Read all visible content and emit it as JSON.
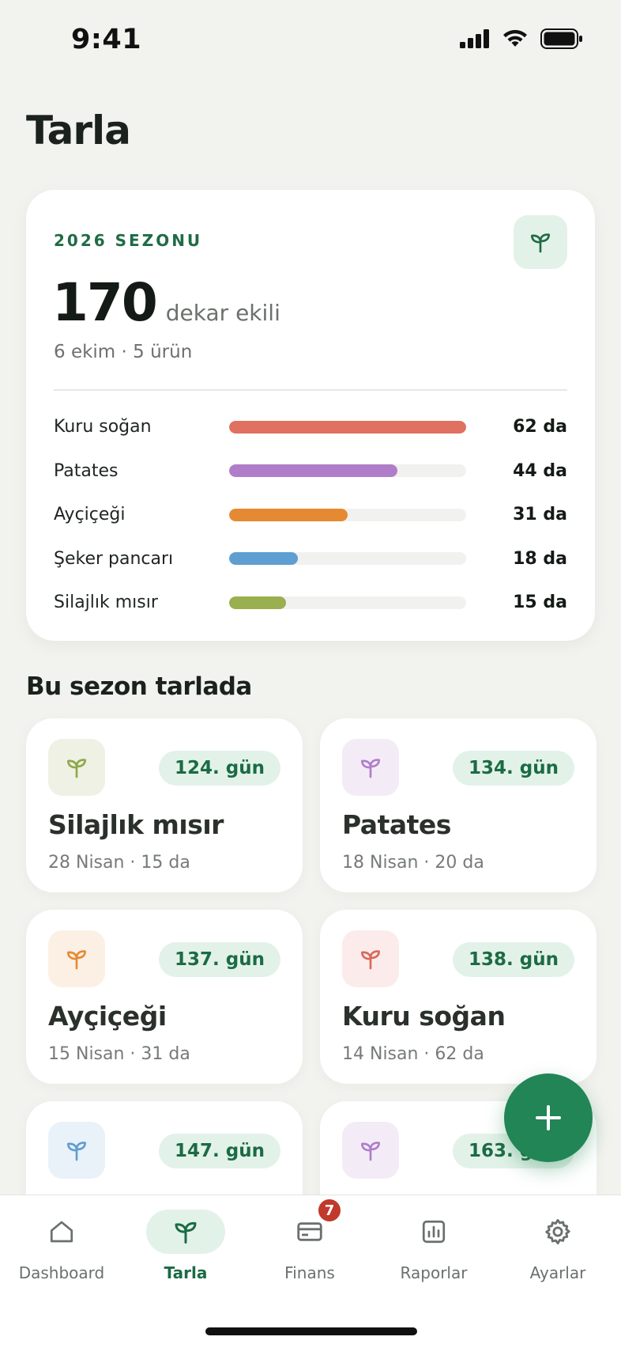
{
  "status_bar": {
    "time": "9:41"
  },
  "page": {
    "title": "Tarla"
  },
  "season": {
    "label": "2026 SEZONU",
    "total_value": "170",
    "total_unit": "dekar ekili",
    "subtitle": "6 ekim · 5 ürün",
    "crops": [
      {
        "name": "Kuru soğan",
        "value": "62 da",
        "fraction": 1.0,
        "color": "#e07060"
      },
      {
        "name": "Patates",
        "value": "44 da",
        "fraction": 0.71,
        "color": "#b07ec8"
      },
      {
        "name": "Ayçiçeği",
        "value": "31 da",
        "fraction": 0.5,
        "color": "#e58a32"
      },
      {
        "name": "Şeker pancarı",
        "value": "18 da",
        "fraction": 0.29,
        "color": "#5f9ed1"
      },
      {
        "name": "Silajlık mısır",
        "value": "15 da",
        "fraction": 0.24,
        "color": "#9aaf4f"
      }
    ]
  },
  "section": {
    "title": "Bu sezon tarlada"
  },
  "fields": [
    {
      "name": "Silajlık mısır",
      "meta": "28 Nisan · 15 da",
      "badge": "124. gün",
      "icon_color": "#8ea84a",
      "icon_bg": "#eef1e4"
    },
    {
      "name": "Patates",
      "meta": "18 Nisan · 20 da",
      "badge": "134. gün",
      "icon_color": "#b07ec8",
      "icon_bg": "#f3ecf7"
    },
    {
      "name": "Ayçiçeği",
      "meta": "15 Nisan · 31 da",
      "badge": "137. gün",
      "icon_color": "#e58a32",
      "icon_bg": "#fcf0e4"
    },
    {
      "name": "Kuru soğan",
      "meta": "14 Nisan · 62 da",
      "badge": "138. gün",
      "icon_color": "#d9685a",
      "icon_bg": "#fbeceb"
    },
    {
      "name": "",
      "meta": "",
      "badge": "147. gün",
      "icon_color": "#5f9ed1",
      "icon_bg": "#e9f1f9"
    },
    {
      "name": "",
      "meta": "",
      "badge": "163. gün",
      "icon_color": "#b07ec8",
      "icon_bg": "#f3ecf7"
    }
  ],
  "tabs": [
    {
      "label": "Dashboard",
      "icon": "home-icon"
    },
    {
      "label": "Tarla",
      "icon": "sprout-icon",
      "active": true
    },
    {
      "label": "Finans",
      "icon": "card-icon",
      "badge": "7"
    },
    {
      "label": "Raporlar",
      "icon": "chart-icon"
    },
    {
      "label": "Ayarlar",
      "icon": "gear-icon"
    }
  ],
  "colors": {
    "brand": "#218556",
    "brand_dark": "#1b6b44",
    "brand_soft": "#e3f2e8"
  }
}
